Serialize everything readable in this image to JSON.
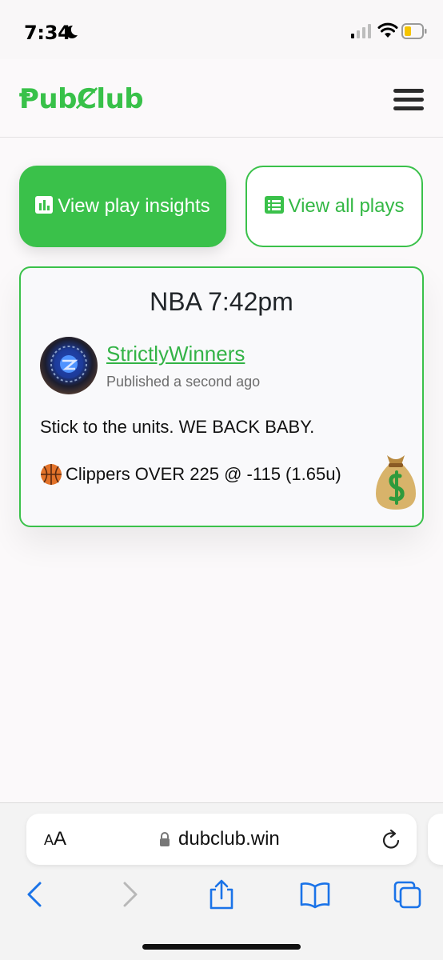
{
  "status_bar": {
    "time": "7:34",
    "icons": [
      "moon-icon",
      "signal-icon",
      "wifi-icon",
      "battery-icon"
    ]
  },
  "header": {
    "logo": "ⱣubȻlub",
    "menu_icon": "hamburger-icon"
  },
  "actions": {
    "insights_label": "View play insights",
    "insights_icon": "bar-chart-icon",
    "plays_label": "View all plays",
    "plays_icon": "list-icon"
  },
  "play": {
    "title": "NBA 7:42pm",
    "author": "StrictlyWinners",
    "published": "Published a second ago",
    "message": "Stick to the units. WE BACK BABY.",
    "pick": "Clippers OVER 225 @ -115 (1.65u)",
    "pick_icon": "basketball-icon",
    "reaction_icon": "money-bag-icon"
  },
  "browser": {
    "aa_small": "A",
    "aa_big": "A",
    "url": "dubclub.win",
    "toolbar": [
      "back-icon",
      "forward-icon",
      "share-icon",
      "bookmarks-icon",
      "tabs-icon"
    ]
  },
  "colors": {
    "brand_green": "#3ac14a",
    "background": "#fbf9fa",
    "link_blue": "#1a73e8"
  }
}
